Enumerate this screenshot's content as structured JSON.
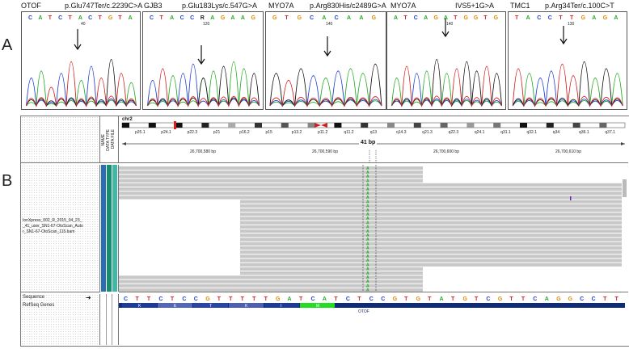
{
  "panel_a": {
    "letter": "A",
    "chromatograms": [
      {
        "title_left": "OTOF",
        "title_right": "p.Glu747Ter/c.2239C>A",
        "bases": [
          "C",
          "A",
          "T",
          "C",
          "T",
          "A",
          "C",
          "T",
          "G",
          "T",
          "A"
        ],
        "position": "40"
      },
      {
        "title_left": "GJB3",
        "title_right": "p.Glu183Lys/c.547G>A",
        "bases": [
          "C",
          "T",
          "A",
          "C",
          "C",
          "R",
          "A",
          "G",
          "A",
          "A",
          "G"
        ],
        "position": "120"
      },
      {
        "title_left": "MYO7A",
        "title_right": "p.Arg830His/c2489G>A",
        "bases": [
          "G",
          "T",
          "G",
          "C",
          "A",
          "C",
          "A",
          "A",
          "G"
        ],
        "position": "140"
      },
      {
        "title_left": "MYO7A",
        "title_right": "IVS5+1G>A",
        "bases": [
          "A",
          "T",
          "C",
          "A",
          "G",
          "A",
          "T",
          "G",
          "G",
          "T",
          "G"
        ],
        "position": "140"
      },
      {
        "title_left": "TMC1",
        "title_right": "p.Arg34Ter/c.100C>T",
        "bases": [
          "T",
          "A",
          "C",
          "C",
          "T",
          "T",
          "G",
          "A",
          "G",
          "A"
        ],
        "position": "130"
      }
    ]
  },
  "panel_b": {
    "letter": "B",
    "chromosome": "chr2",
    "bands": [
      "p25.1",
      "p24.1",
      "p22.3",
      "p21",
      "p16.2",
      "p15",
      "p13.2",
      "p11.2",
      "q11.2",
      "q13",
      "q14.3",
      "q21.3",
      "q22.3",
      "q24.1",
      "q31.1",
      "q32.1",
      "q34",
      "q36.1",
      "q37.1"
    ],
    "ruler_span": "41 bp",
    "ruler_ticks": [
      "26,700,580 bp",
      "26,700,590 bp",
      "26,700,600 bp",
      "26,700,610 bp"
    ],
    "column_headers": [
      "NAME",
      "DATA TYPE",
      "DATA FILE"
    ],
    "track_name_lines": [
      "IonXpress_002_R_2015_04_23_",
      "_41_user_SN1-67-OtoScan_Auto",
      "r_SN1-67-OtoScan_115.bam"
    ],
    "variant_base": "A",
    "sequence_label": "Sequence",
    "refseq_label": "RefSeq Genes",
    "sequence": [
      "C",
      "T",
      "T",
      "C",
      "T",
      "C",
      "C",
      "G",
      "T",
      "T",
      "T",
      "T",
      "T",
      "G",
      "A",
      "T",
      "C",
      "A",
      "T",
      "C",
      "T",
      "C",
      "C",
      "G",
      "T",
      "G",
      "T",
      "A",
      "T",
      "G",
      "T",
      "C",
      "G",
      "T",
      "T",
      "C",
      "A",
      "G",
      "G",
      "C",
      "C",
      "T",
      "T"
    ],
    "amino_acids": [
      "K",
      "E",
      "T",
      "K",
      "I",
      "M"
    ],
    "gene_name": "OTOF",
    "colors": {
      "A": "#22aa22",
      "C": "#1f3fd0",
      "G": "#e08a00",
      "T": "#d42020",
      "read": "#c8c8c8",
      "amino_highlight": "#22dd22",
      "gene": "#102a7a"
    }
  }
}
